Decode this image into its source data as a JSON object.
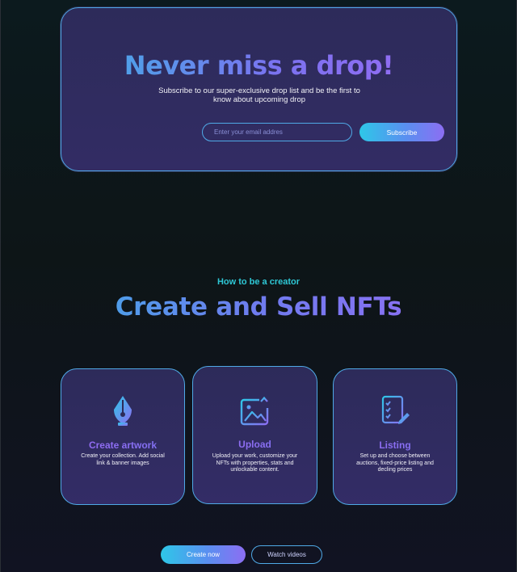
{
  "newsletter": {
    "title": "Never miss a drop!",
    "subtitle": "Subscribe to our super-exclusive drop list and be the first to know about upcoming drop",
    "email_placeholder": "Enter your email addres",
    "subscribe_label": "Subscribe"
  },
  "creator": {
    "eyebrow": "How to be a creator",
    "title": "Create and Sell NFTs",
    "cards": [
      {
        "title": "Create artwork",
        "description": "Create your collection. Add social link & banner images",
        "icon": "pen-nib-icon"
      },
      {
        "title": "Upload",
        "description": "Upload your work, customize your NFTs with properties, stats and unlockable content.",
        "icon": "image-upload-icon"
      },
      {
        "title": "Listing",
        "description": "Set up and choose between auctions, fixed-price listing and decling prices",
        "icon": "checklist-edit-icon"
      }
    ],
    "create_label": "Create now",
    "watch_label": "Watch videos"
  },
  "colors": {
    "background": "#0d1517",
    "card": "#2f2b5e",
    "accent_cyan": "#2ec7e8",
    "accent_purple": "#8c6ef3",
    "border": "#4fa9e6"
  }
}
